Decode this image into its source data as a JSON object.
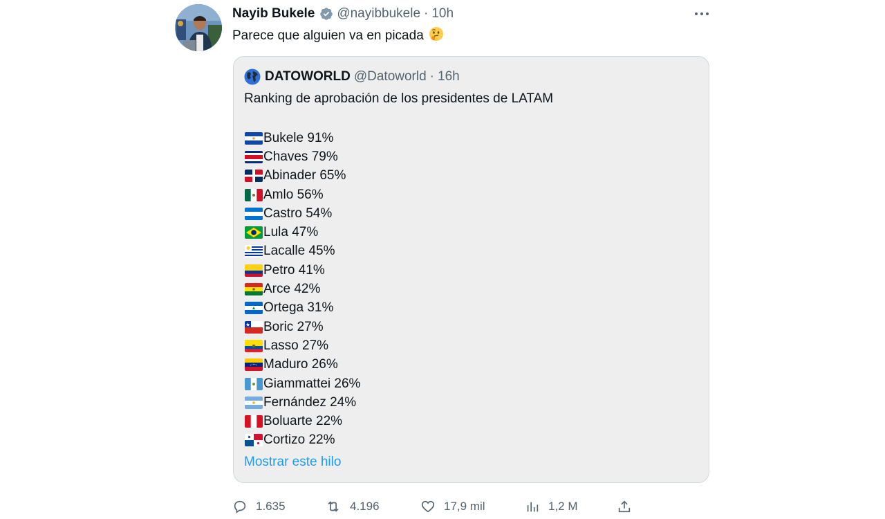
{
  "tweet": {
    "author_name": "Nayib Bukele",
    "handle": "@nayibbukele",
    "separator": "·",
    "time": "10h",
    "text": "Parece que alguien va en picada",
    "text_emoji": "🤔",
    "more_icon": "more-horizontal-icon",
    "verified_color": "#829aab"
  },
  "quoted": {
    "author_name": "DATOWORLD",
    "handle": "@Datoworld",
    "separator": "·",
    "time": "16h",
    "title": "Ranking de aprobación de los presidentes de LATAM",
    "ranking": [
      {
        "label": "Bukele 91%",
        "flag": "el-salvador"
      },
      {
        "label": "Chaves 79%",
        "flag": "costa-rica"
      },
      {
        "label": "Abinader 65%",
        "flag": "dominican-republic"
      },
      {
        "label": "Amlo 56%",
        "flag": "mexico"
      },
      {
        "label": "Castro 54%",
        "flag": "honduras"
      },
      {
        "label": "Lula 47%",
        "flag": "brazil"
      },
      {
        "label": "Lacalle 45%",
        "flag": "uruguay"
      },
      {
        "label": "Petro 41%",
        "flag": "colombia"
      },
      {
        "label": "Arce 42%",
        "flag": "bolivia"
      },
      {
        "label": "Ortega 31%",
        "flag": "nicaragua"
      },
      {
        "label": "Boric 27%",
        "flag": "chile"
      },
      {
        "label": "Lasso 27%",
        "flag": "ecuador"
      },
      {
        "label": "Maduro 26%",
        "flag": "venezuela"
      },
      {
        "label": "Giammattei 26%",
        "flag": "guatemala"
      },
      {
        "label": "Fernández 24%",
        "flag": "argentina"
      },
      {
        "label": "Boluarte 22%",
        "flag": "peru"
      },
      {
        "label": "Cortizo 22%",
        "flag": "panama"
      }
    ],
    "show_thread": "Mostrar este hilo",
    "link_color": "#1d9bf0"
  },
  "actions": {
    "replies": "1.635",
    "retweets": "4.196",
    "likes": "17,9 mil",
    "views": "1,2 M"
  }
}
